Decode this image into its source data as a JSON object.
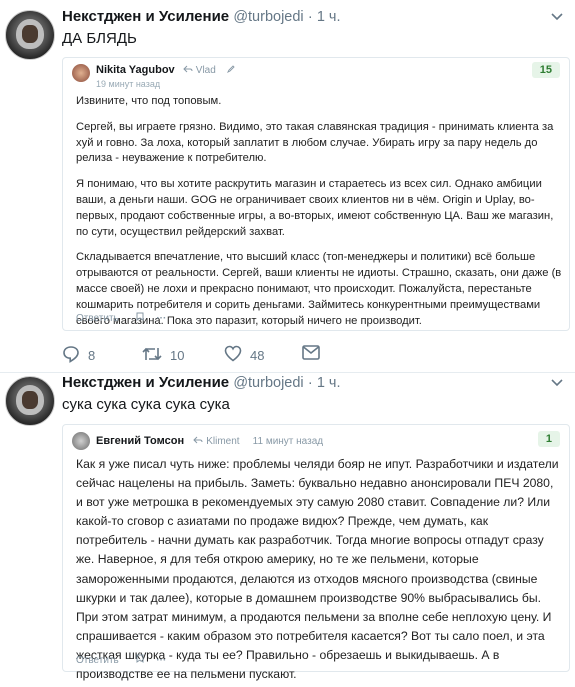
{
  "tweets": [
    {
      "author_name": "Некстджен и Усиление",
      "handle": "@turbojedi",
      "dot": "·",
      "time": "1 ч.",
      "text": "ДА БЛЯДЬ",
      "quote": {
        "author": "Nikita Yagubov",
        "reply_to": "Vlad",
        "time": "19 минут назад",
        "score": "15",
        "paragraphs": [
          "Извините, что под топовым.",
          "Сергей, вы играете грязно. Видимо, это такая славянская традиция - принимать клиента за хуй и говно. За лоха, который заплатит в любом случае. Убирать игру за пару недель до релиза - неуважение к потребителю.",
          "Я понимаю, что вы хотите раскрутить магазин и стараетесь из всех сил. Однако амбиции ваши, а деньги наши. GOG не ограничивает своих клиентов ни в чём. Origin и Uplay, во-первых, продают собственные игры, а во-вторых, имеют собственную ЦА. Ваш же магазин, по сути, осуществил рейдерский захват.",
          "Складывается впечатление, что высший класс (топ-менеджеры и политики) всё больше отрываются от реальности. Сергей, ваши клиенты не идиоты. Страшно, сказать, они даже (в массе своей) не лохи и прекрасно понимают, что происходит. Пожалуйста, перестаньте кошмарить потребителя и сорить деньгами. Займитесь конкурентными преимуществами своего магазина. Пока это паразит, который ничего не производит."
        ],
        "reply_label": "Ответить",
        "more": "···"
      },
      "actions": {
        "replies": "8",
        "retweets": "10",
        "likes": "48"
      }
    },
    {
      "author_name": "Некстджен и Усиление",
      "handle": "@turbojedi",
      "dot": "·",
      "time": "1 ч.",
      "text": "сука сука сука сука сука",
      "quote": {
        "author": "Евгений Томсон",
        "reply_to": "Kliment",
        "time": "11 минут назад",
        "score": "1",
        "body": "Как я уже писал чуть ниже: проблемы челяди бояр не ипут. Разработчики и издатели сейчас нацелены на прибыль. Заметь: буквально недавно анонсировали ПЕЧ 2080, и вот уже метрошка в рекомендуемых эту самую 2080 ставит. Совпадение ли? Или какой-то сговор с азиатами по продаже видюх? Прежде, чем думать, как потребитель - начни думать как разработчик. Тогда многие вопросы отпадут сразу же. Наверное, я для тебя открою америку, но те же пельмени, которые замороженными продаются, делаются из отходов мясного производства (свиные шкурки и так далее), которые в домашнем производстве 90% выбрасывались бы. При этом затрат минимум, а продаются пельмени за вполне себе неплохую цену. И спрашивается - каким образом это потребителя касается? Вот ты сало поел, и эта жесткая шкурка - куда ты ее? Правильно - обрезаешь и выкидываешь. А в производстве ее на пельмени пускают.",
        "reply_label": "Ответить",
        "more": "···"
      }
    }
  ],
  "icons": [
    "chevron-down-icon",
    "reply-icon",
    "pencil-icon",
    "reply-arrow-icon",
    "bookmark-icon",
    "more-icon",
    "retweet-icon",
    "heart-icon",
    "mail-icon"
  ],
  "colors": {
    "score_bg": "#e6f4e8",
    "score_text": "#2e7d32",
    "muted": "#657786"
  }
}
